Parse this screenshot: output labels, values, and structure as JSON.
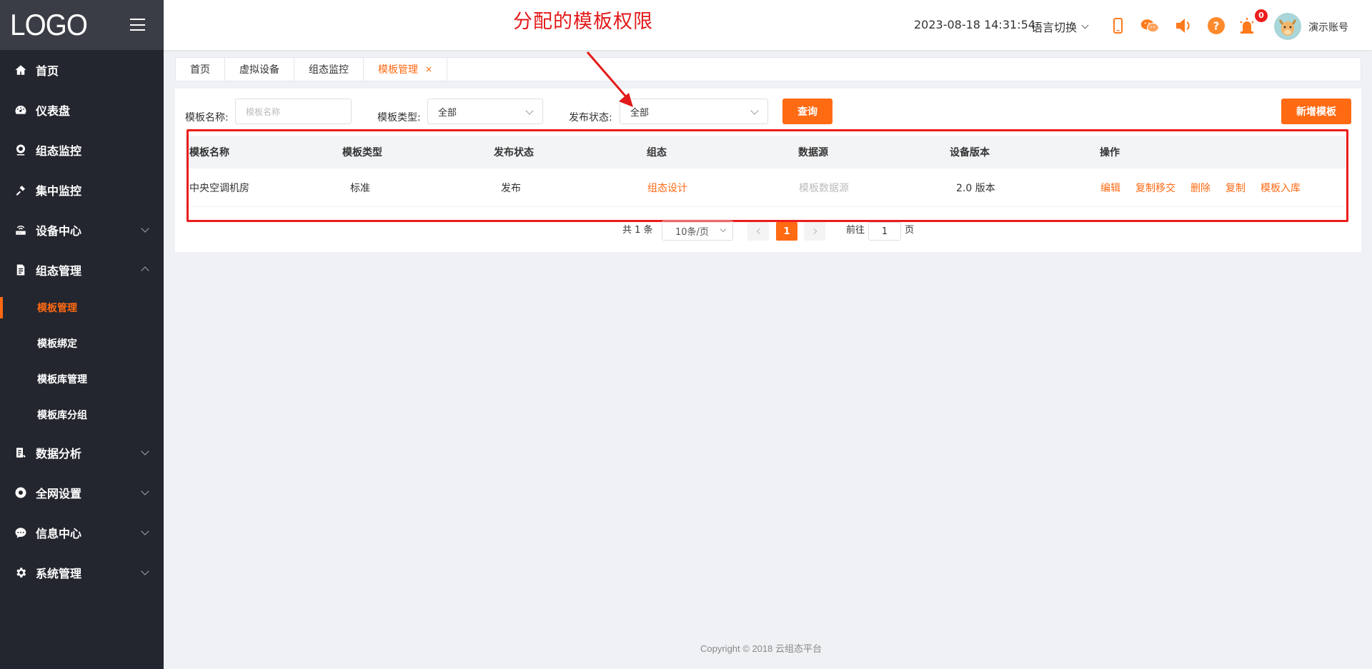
{
  "logo": "LOGO",
  "sidebar": {
    "items": [
      {
        "label": "首页",
        "icon": "home-icon"
      },
      {
        "label": "仪表盘",
        "icon": "dashboard-icon"
      },
      {
        "label": "组态监控",
        "icon": "monitor-icon"
      },
      {
        "label": "集中监控",
        "icon": "centralized-monitor-icon"
      },
      {
        "label": "设备中心",
        "icon": "router-icon"
      },
      {
        "label": "组态管理",
        "icon": "document-icon"
      },
      {
        "label": "数据分析",
        "icon": "analysis-icon"
      },
      {
        "label": "全网设置",
        "icon": "settings-circle-icon"
      },
      {
        "label": "信息中心",
        "icon": "message-icon"
      },
      {
        "label": "系统管理",
        "icon": "gear-icon"
      }
    ],
    "submenu": [
      "模板管理",
      "模板绑定",
      "模板库管理",
      "模板库分组"
    ]
  },
  "header": {
    "annotation": "分配的模板权限",
    "datetime": "2023-08-18 14:31:54",
    "lang": "语言切换",
    "alarm_count": "0",
    "account": "演示账号"
  },
  "tabs": [
    {
      "label": "首页"
    },
    {
      "label": "虚拟设备"
    },
    {
      "label": "组态监控"
    },
    {
      "label": "模板管理",
      "closable": "×"
    }
  ],
  "filters": {
    "name_label": "模板名称:",
    "name_placeholder": "模板名称",
    "type_label": "模板类型:",
    "type_value": "全部",
    "status_label": "发布状态:",
    "status_value": "全部",
    "query_btn": "查询",
    "add_btn": "新增模板"
  },
  "table": {
    "headers": [
      "模板名称",
      "模板类型",
      "发布状态",
      "组态",
      "数据源",
      "设备版本",
      "操作"
    ],
    "rows": [
      {
        "name": "中央空调机房",
        "type": "标准",
        "status": "发布",
        "config": "组态设计",
        "source": "模板数据源",
        "version": "2.0 版本",
        "actions": [
          "编辑",
          "复制移交",
          "删除",
          "复制",
          "模板入库"
        ]
      }
    ]
  },
  "pagination": {
    "total": "共 1 条",
    "page_size": "10条/页",
    "current": "1",
    "goto_prefix": "前往",
    "goto_value": "1",
    "goto_suffix": "页"
  },
  "footer": "Copyright © 2018 云组态平台",
  "colors": {
    "accent": "#ff6a13",
    "sidebar": "#23262e",
    "annotation": "#e31a1a"
  }
}
